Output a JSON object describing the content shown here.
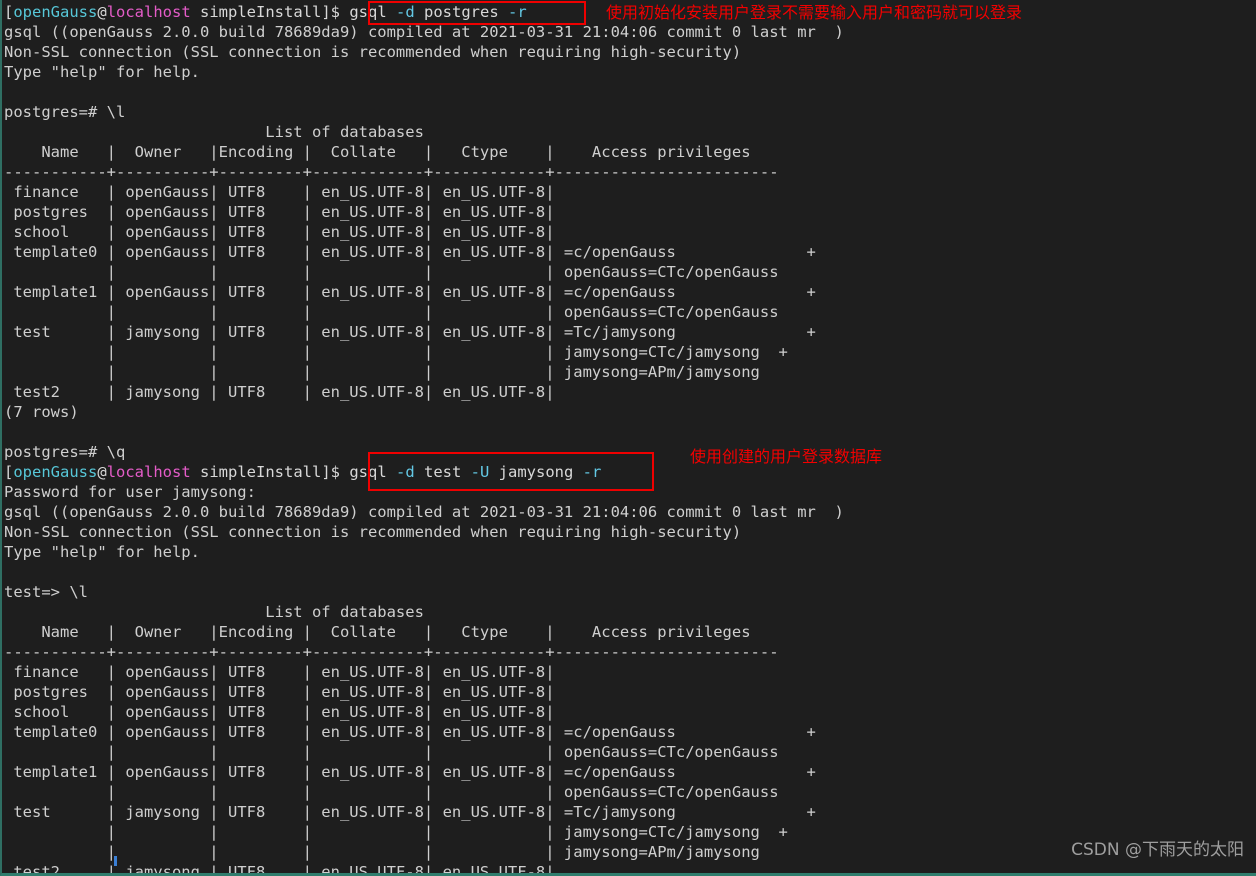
{
  "terminal": {
    "shell_user": "openGauss",
    "shell_host": "localhost",
    "shell_dir": "simpleInstall",
    "prompt_bracket_open": "[",
    "prompt_at": "@",
    "prompt_close": "]$ ",
    "version_banner": "gsql ((openGauss 2.0.0 build 78689da9) compiled at 2021-03-31 21:04:06 commit 0 last mr  )",
    "ssl_banner": "Non-SSL connection (SSL connection is recommended when requiring high-security)",
    "help_banner": "Type \"help\" for help.",
    "password_prompt": "Password for user jamysong:",
    "prompt_postgres": "postgres=# ",
    "prompt_test": "test=> ",
    "cmd_list": "\\l",
    "cmd_quit": "\\q",
    "rows_count": "(7 rows)",
    "command_1": {
      "program": "gsql",
      "flag_d": "-d",
      "db": "postgres",
      "flag_r": "-r",
      "full": "gsql -d postgres -r"
    },
    "command_2": {
      "program": "gsql",
      "flag_d": "-d",
      "db": "test",
      "flag_u": "-U",
      "user": "jamysong",
      "flag_r": "-r",
      "full": "gsql -d test -U jamysong -r"
    }
  },
  "table": {
    "title": "List of databases",
    "headers": [
      "Name",
      "Owner",
      "Encoding",
      "Collate",
      "Ctype",
      "Access privileges"
    ],
    "separator": "-----------+-----------+----------+-------------+-------------+-----------------------",
    "rows": [
      {
        "name": "finance",
        "owner": "openGauss",
        "encoding": "UTF8",
        "collate": "en_US.UTF-8",
        "ctype": "en_US.UTF-8",
        "privileges": []
      },
      {
        "name": "postgres",
        "owner": "openGauss",
        "encoding": "UTF8",
        "collate": "en_US.UTF-8",
        "ctype": "en_US.UTF-8",
        "privileges": []
      },
      {
        "name": "school",
        "owner": "openGauss",
        "encoding": "UTF8",
        "collate": "en_US.UTF-8",
        "ctype": "en_US.UTF-8",
        "privileges": []
      },
      {
        "name": "template0",
        "owner": "openGauss",
        "encoding": "UTF8",
        "collate": "en_US.UTF-8",
        "ctype": "en_US.UTF-8",
        "privileges": [
          "=c/openGauss              +",
          "openGauss=CTc/openGauss"
        ]
      },
      {
        "name": "template1",
        "owner": "openGauss",
        "encoding": "UTF8",
        "collate": "en_US.UTF-8",
        "ctype": "en_US.UTF-8",
        "privileges": [
          "=c/openGauss              +",
          "openGauss=CTc/openGauss"
        ]
      },
      {
        "name": "test",
        "owner": "jamysong",
        "encoding": "UTF8",
        "collate": "en_US.UTF-8",
        "ctype": "en_US.UTF-8",
        "privileges": [
          "=Tc/jamysong              +",
          "jamysong=CTc/jamysong  +",
          "jamysong=APm/jamysong"
        ]
      },
      {
        "name": "test2",
        "owner": "jamysong",
        "encoding": "UTF8",
        "collate": "en_US.UTF-8",
        "ctype": "en_US.UTF-8",
        "privileges": []
      }
    ]
  },
  "annotations": {
    "note_1": "使用初始化安装用户登录不需要输入用户和密码就可以登录",
    "note_2": "使用创建的用户登录数据库"
  },
  "watermark": "CSDN @下雨天的太阳",
  "colors": {
    "background": "#1e1e1e",
    "foreground": "#d6d6d6",
    "prompt_user": "#57c7d8",
    "prompt_host": "#e45cc8",
    "flag": "#63c8e4",
    "annotation_red": "#f30000",
    "border_teal": "#2f7d6d"
  }
}
